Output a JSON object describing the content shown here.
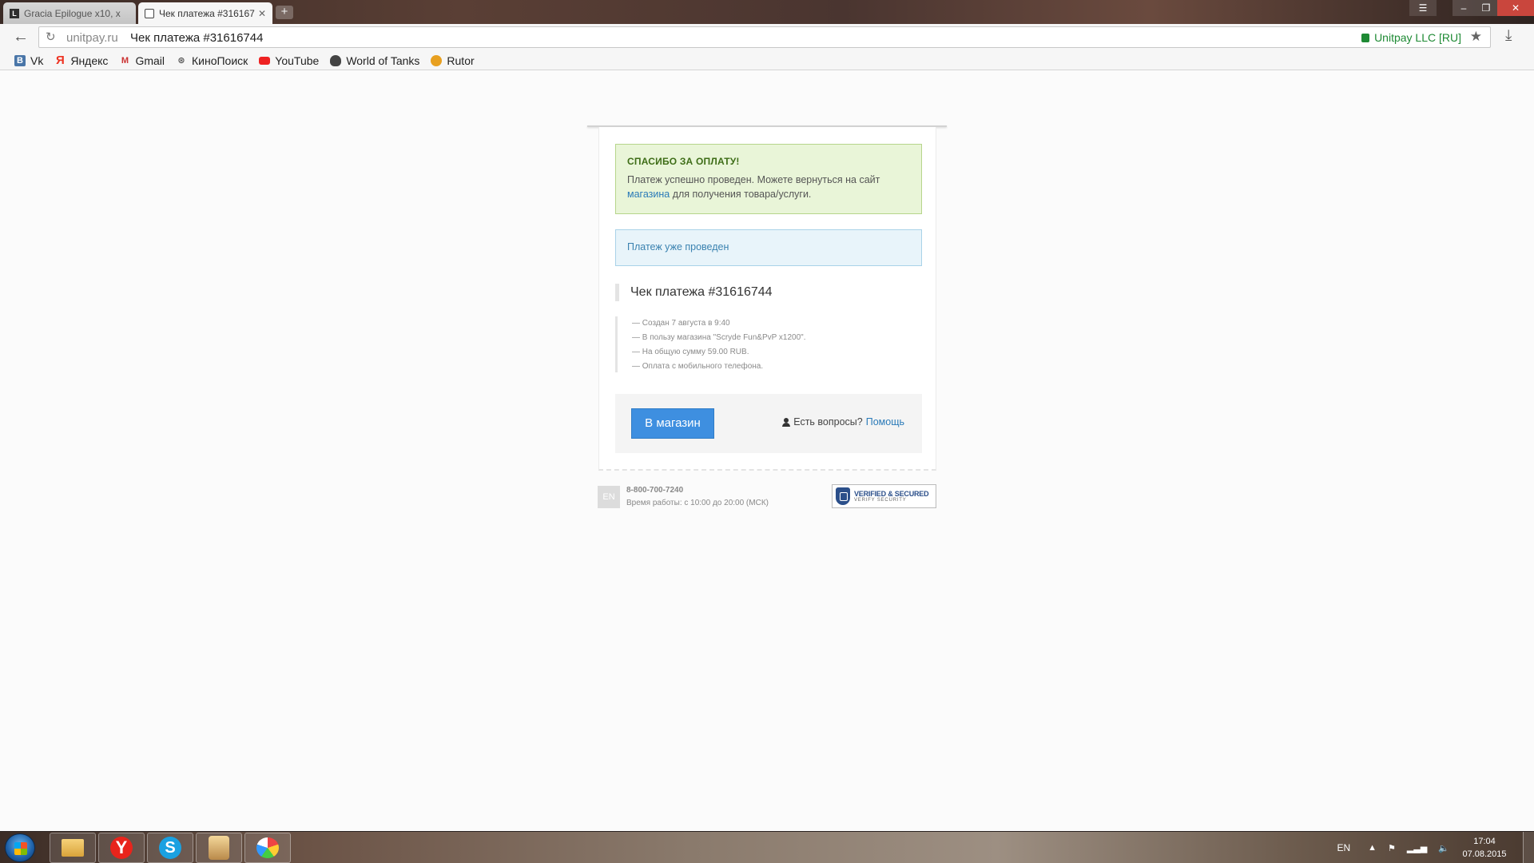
{
  "browser": {
    "tabs": [
      {
        "label": "Gracia Epilogue x10, x",
        "active": false
      },
      {
        "label": "Чек платежа #316167",
        "active": true
      }
    ],
    "newtab_label": "+",
    "url_host": "unitpay.ru",
    "url_title": "Чек платежа #31616744",
    "ev_label": "Unitpay LLC [RU]",
    "bookmarks": [
      {
        "label": "Vk",
        "icon": "vk-icon"
      },
      {
        "label": "Яндекс",
        "icon": "yandex-icon"
      },
      {
        "label": "Gmail",
        "icon": "gmail-icon"
      },
      {
        "label": "КиноПоиск",
        "icon": "kinopoisk-icon"
      },
      {
        "label": "YouTube",
        "icon": "youtube-icon"
      },
      {
        "label": "World of Tanks",
        "icon": "wot-icon"
      },
      {
        "label": "Rutor",
        "icon": "rutor-icon"
      }
    ]
  },
  "page": {
    "success": {
      "title": "СПАСИБО ЗА ОПЛАТУ!",
      "text_part1": "Платеж успешно проведен. Можете вернуться на сайт",
      "link": "магазина",
      "text_part2": "для получения товара/услуги."
    },
    "info": "Платеж уже проведен",
    "receipt_title": "Чек платежа #31616744",
    "details": [
      "— Создан 7 августа в 9:40",
      "— В пользу магазина \"Scryde Fun&PvP x1200\".",
      "— На общую сумму 59.00 RUB.",
      "— Оплата с мобильного телефона."
    ],
    "shop_button": "В магазин",
    "help_question": "Есть вопросы?",
    "help_link": "Помощь"
  },
  "footer": {
    "lang": "EN",
    "phone": "8-800-700-7240",
    "hours": "Время работы: с 10:00 до 20:00 (МСК)",
    "seal_line1": "VERIFIED & SECURED",
    "seal_line2": "VERIFY SECURITY"
  },
  "taskbar": {
    "lang": "EN",
    "time": "17:04",
    "date": "07.08.2015",
    "yandex_letter": "Y",
    "skype_letter": "S"
  }
}
